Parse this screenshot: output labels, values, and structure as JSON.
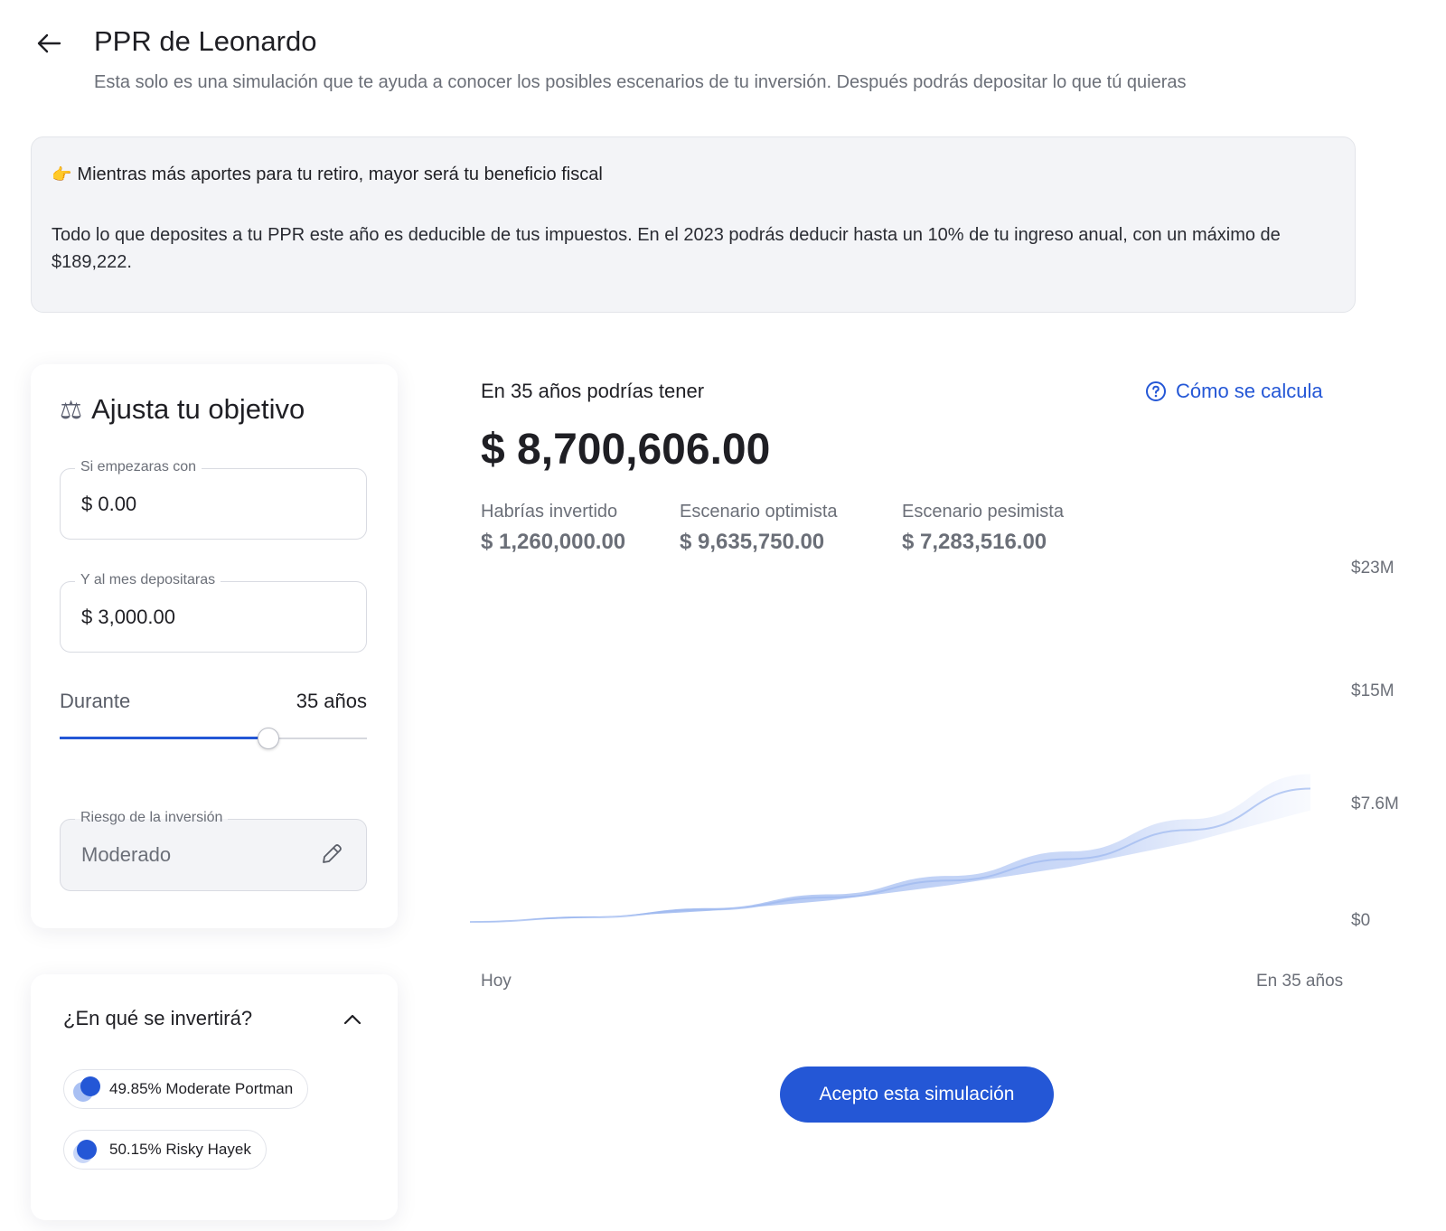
{
  "header": {
    "title": "PPR de Leonardo",
    "subtitle": "Esta solo es una simulación que te ayuda a conocer los posibles escenarios de tu inversión. Después podrás depositar lo que tú quieras"
  },
  "info": {
    "emoji": "👉",
    "headline": "Mientras más aportes para tu retiro, mayor será tu beneficio fiscal",
    "body": "Todo lo que deposites a tu PPR este año es deducible de tus impuestos. En el 2023 podrás deducir hasta un 10% de tu ingreso anual, con un máximo de $189,222."
  },
  "objective": {
    "title": "Ajusta tu objetivo",
    "initial_label": "Si empezaras con",
    "initial_value": "$ 0.00",
    "monthly_label": "Y al mes depositaras",
    "monthly_value": "$ 3,000.00",
    "duration_label": "Durante",
    "duration_value": "35 años",
    "duration_slider_fraction": 0.68,
    "risk_label": "Riesgo de la inversión",
    "risk_value": "Moderado"
  },
  "investments": {
    "title": "¿En qué se invertirá?",
    "funds": [
      {
        "label": "49.85% Moderate Portman",
        "color_front": "#2457d6",
        "color_back": "#a9c0f3"
      },
      {
        "label": "50.15% Risky Hayek",
        "color_front": "#2457d6",
        "color_back": "#c9d7f8"
      }
    ]
  },
  "result": {
    "label": "En 35 años podrías tener",
    "amount": "$ 8,700,606.00",
    "help_link": "Cómo se calcula",
    "stats": [
      {
        "label": "Habrías invertido",
        "value": "$ 1,260,000.00"
      },
      {
        "label": "Escenario optimista",
        "value": "$ 9,635,750.00"
      },
      {
        "label": "Escenario pesimista",
        "value": "$ 7,283,516.00"
      }
    ]
  },
  "chart_data": {
    "type": "area",
    "y_ticks": [
      "$23M",
      "$15M",
      "$7.6M",
      "$0"
    ],
    "y_tick_values": [
      23,
      15,
      7.6,
      0
    ],
    "x_ticks": [
      "Hoy",
      "En 35 años"
    ],
    "ylim": [
      0,
      23
    ],
    "x": [
      0,
      5,
      10,
      15,
      20,
      25,
      30,
      35
    ],
    "series": [
      {
        "values": [
          0,
          0.3,
          0.8,
          1.6,
          2.7,
          4.1,
          6.0,
          8.7
        ]
      }
    ],
    "optimistic": [
      0,
      0.35,
      0.9,
      1.8,
      3.0,
      4.6,
      6.7,
      9.64
    ],
    "pessimistic": [
      0,
      0.28,
      0.72,
      1.4,
      2.4,
      3.6,
      5.2,
      7.28
    ],
    "colors": {
      "fill": "#c7d6f7",
      "line": "#9db8ef"
    }
  },
  "actions": {
    "accept": "Acepto esta simulación"
  },
  "colors": {
    "accent": "#2457d6",
    "info_bg": "#f3f4f7"
  }
}
